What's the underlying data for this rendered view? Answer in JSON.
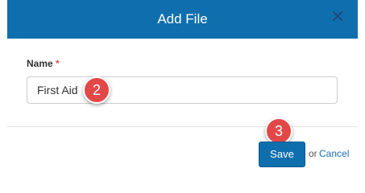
{
  "dialog": {
    "title": "Add File",
    "close_icon": "close-icon",
    "header_color": "#0f6fae"
  },
  "form": {
    "name_label": "Name",
    "required_mark": "*",
    "name_value": "First Aid"
  },
  "annotations": {
    "step_2": "2",
    "step_3": "3",
    "badge_color": "#e34849"
  },
  "footer": {
    "save_label": "Save",
    "or_text": "or",
    "cancel_label": "Cancel"
  }
}
